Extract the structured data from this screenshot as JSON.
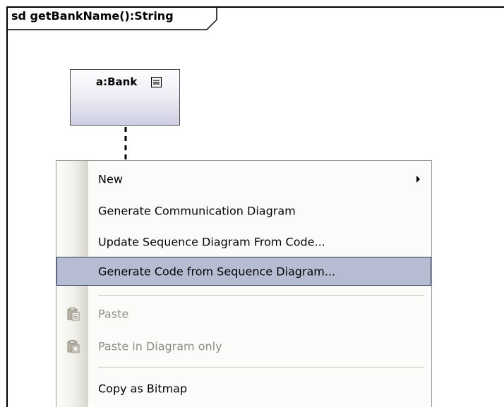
{
  "diagram": {
    "frame_title": "sd getBankName():String",
    "lifeline": {
      "name": "a:Bank",
      "icon": "lifeline-menu-icon"
    }
  },
  "context_menu": {
    "items": [
      {
        "label": "New",
        "has_submenu": true,
        "enabled": true
      },
      {
        "label": "Generate Communication Diagram",
        "enabled": true
      },
      {
        "label": "Update Sequence Diagram From Code...",
        "enabled": true
      },
      {
        "label": "Generate Code from Sequence Diagram...",
        "enabled": true,
        "highlighted": true
      },
      {
        "label": "Paste",
        "enabled": false,
        "icon": "paste-icon"
      },
      {
        "label": "Paste in Diagram only",
        "enabled": false,
        "icon": "paste-in-diagram-icon"
      },
      {
        "label": "Copy as Bitmap",
        "enabled": true
      }
    ]
  },
  "colors": {
    "highlight": "#b6bdd2",
    "highlight_border": "#2e3a6a",
    "disabled_text": "#8e8d86"
  }
}
